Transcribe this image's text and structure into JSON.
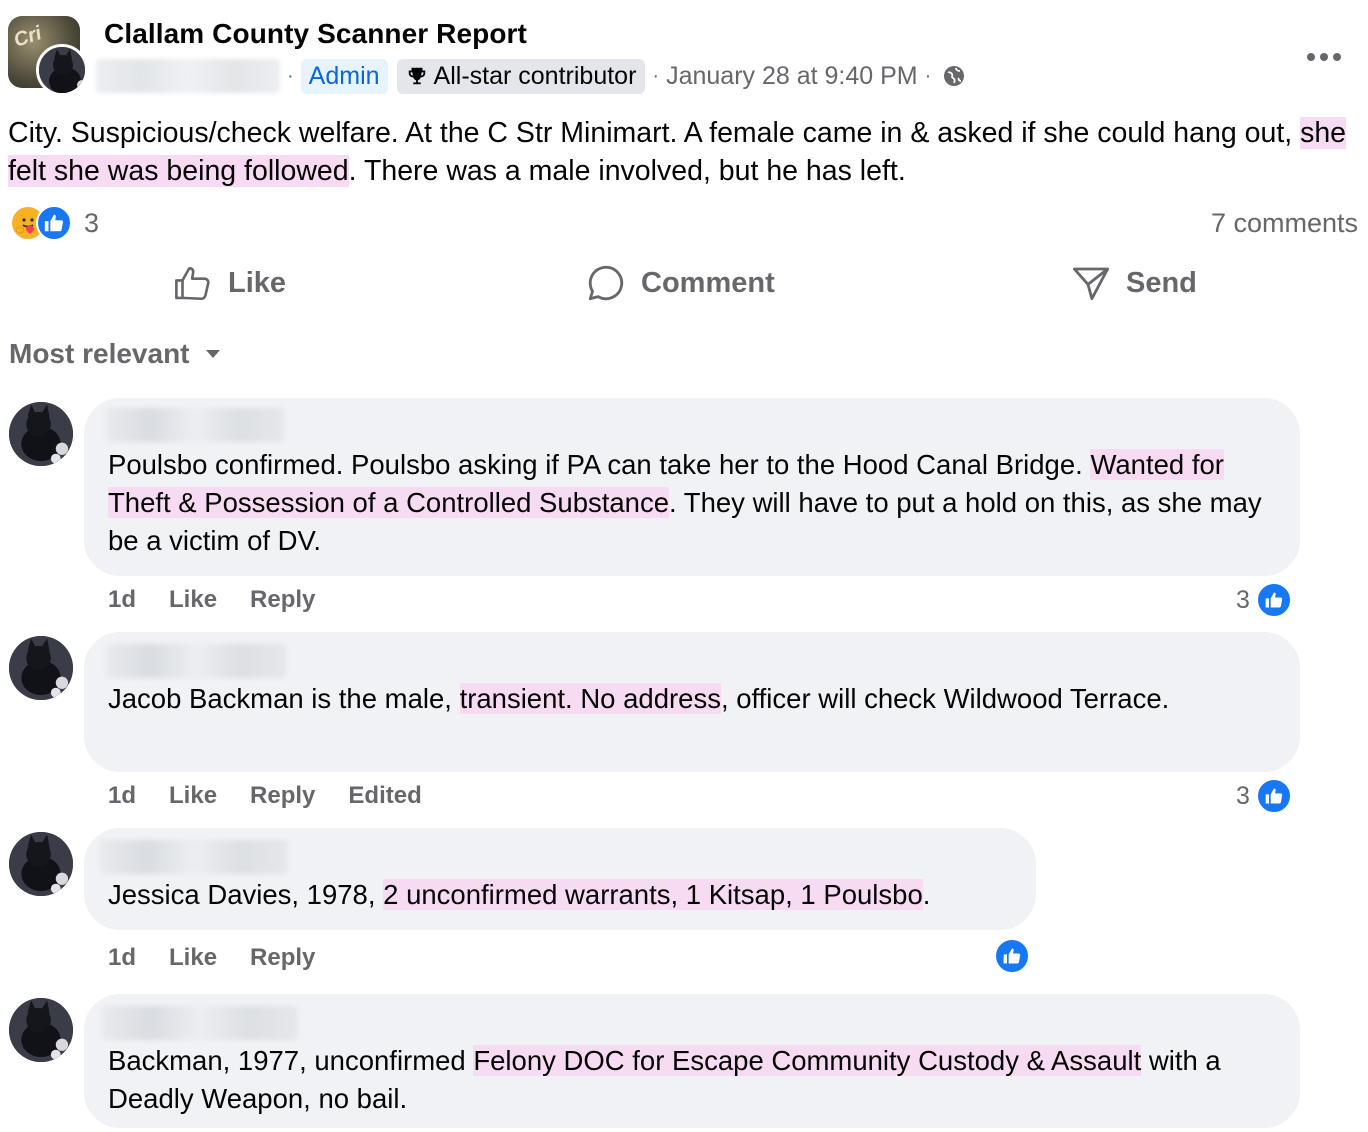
{
  "post": {
    "group_name": "Clallam County Scanner Report",
    "group_avatar_label": "Cri",
    "admin_label": "Admin",
    "allstar_label": "All-star contributor",
    "timestamp": "January 28 at 9:40 PM",
    "audience_icon": "globe-icon",
    "more_icon": "more-horizontal-icon",
    "text_part1": "City.  Suspicious/check welfare.  At the C Str Minimart. A female came in & asked if she could hang out, ",
    "text_highlight": "she felt she was being followed",
    "text_part2": ".  There was a male involved,  but he has left.",
    "reaction_count": "3",
    "comments_count": "7 comments"
  },
  "actions": {
    "like_label": "Like",
    "comment_label": "Comment",
    "send_label": "Send"
  },
  "sort": {
    "label": "Most relevant"
  },
  "comments": [
    {
      "text_part1": "Poulsbo confirmed. Poulsbo asking if PA can take her to the Hood Canal Bridge. ",
      "text_highlight": "Wanted for Theft & Possession of a Controlled Substance",
      "text_part2": ". They will have to put a hold on this, as she may be a victim of DV.",
      "time": "1d",
      "like": "Like",
      "reply": "Reply",
      "reaction_count": "3"
    },
    {
      "text_part1": "Jacob Backman is the male, ",
      "text_highlight": "transient. No address",
      "text_part2": ", officer will check Wildwood Terrace.",
      "time": "1d",
      "like": "Like",
      "reply": "Reply",
      "edited": "Edited",
      "reaction_count": "3"
    },
    {
      "text_part1": "Jessica Davies, 1978, ",
      "text_highlight": "2 unconfirmed warrants, 1 Kitsap, 1 Poulsbo",
      "text_part2": ".",
      "time": "1d",
      "like": "Like",
      "reply": "Reply"
    },
    {
      "text_part1": "Backman, 1977, unconfirmed ",
      "text_highlight": "Felony DOC for Escape Community Custody & Assault",
      "text_part2": " with a Deadly Weapon, no bail."
    }
  ],
  "colors": {
    "accent": "#1877f2",
    "highlight": "#f6dbf2",
    "bubble": "#f0f2f5",
    "secondary_text": "#65676b"
  }
}
